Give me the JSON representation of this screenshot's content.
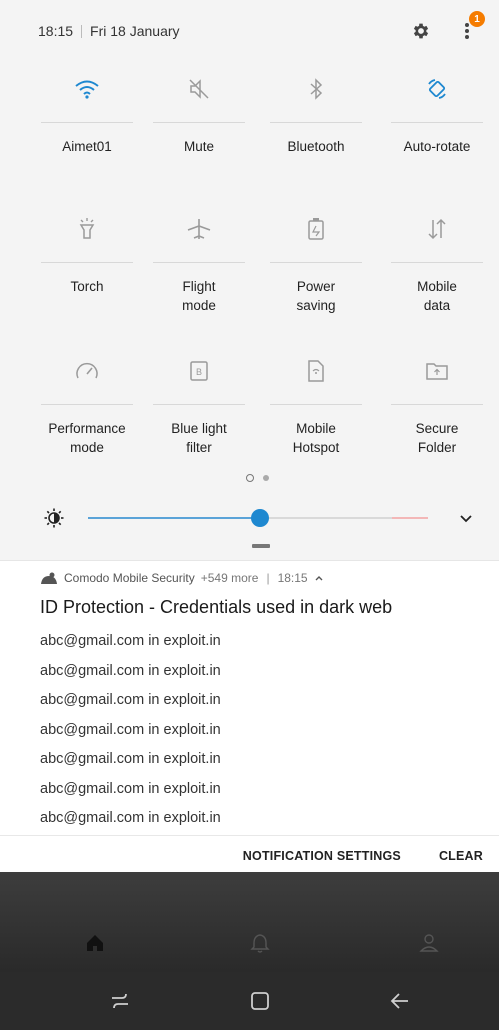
{
  "status": {
    "time": "18:15",
    "date": "Fri 18 January",
    "badge_count": "1",
    "settings_icon": "gear-icon",
    "more_icon": "more-vertical-icon"
  },
  "tiles": [
    {
      "label": "Aimet01",
      "icon": "wifi-icon",
      "active": true
    },
    {
      "label": "Mute",
      "icon": "mute-icon",
      "active": false
    },
    {
      "label": "Bluetooth",
      "icon": "bluetooth-icon",
      "active": false
    },
    {
      "label": "Auto-rotate",
      "icon": "auto-rotate-icon",
      "active": true
    },
    {
      "label": "Torch",
      "icon": "torch-icon",
      "active": false
    },
    {
      "label": "Flight\nmode",
      "icon": "airplane-icon",
      "active": false
    },
    {
      "label": "Power\nsaving",
      "icon": "power-saving-icon",
      "active": false
    },
    {
      "label": "Mobile\ndata",
      "icon": "mobile-data-icon",
      "active": false
    },
    {
      "label": "Performance\nmode",
      "icon": "performance-icon",
      "active": false
    },
    {
      "label": "Blue light\nfilter",
      "icon": "blue-light-icon",
      "active": false
    },
    {
      "label": "Mobile\nHotspot",
      "icon": "hotspot-icon",
      "active": false
    },
    {
      "label": "Secure\nFolder",
      "icon": "secure-folder-icon",
      "active": false
    }
  ],
  "brightness": {
    "level": 0.5
  },
  "notification": {
    "app": "Comodo Mobile Security",
    "more": "+549 more",
    "time": "18:15",
    "title": "ID Protection - Credentials used in dark web",
    "lines": [
      "abc@gmail.com in exploit.in",
      "abc@gmail.com in exploit.in",
      "abc@gmail.com in exploit.in",
      "abc@gmail.com in exploit.in",
      "abc@gmail.com in exploit.in",
      "abc@gmail.com in exploit.in",
      "abc@gmail.com in exploit.in"
    ],
    "actions": {
      "settings": "NOTIFICATION SETTINGS",
      "clear": "CLEAR"
    }
  },
  "colors": {
    "accent": "#1e88d0",
    "panel_bg": "#f4f4f4",
    "badge": "#f57c00"
  }
}
